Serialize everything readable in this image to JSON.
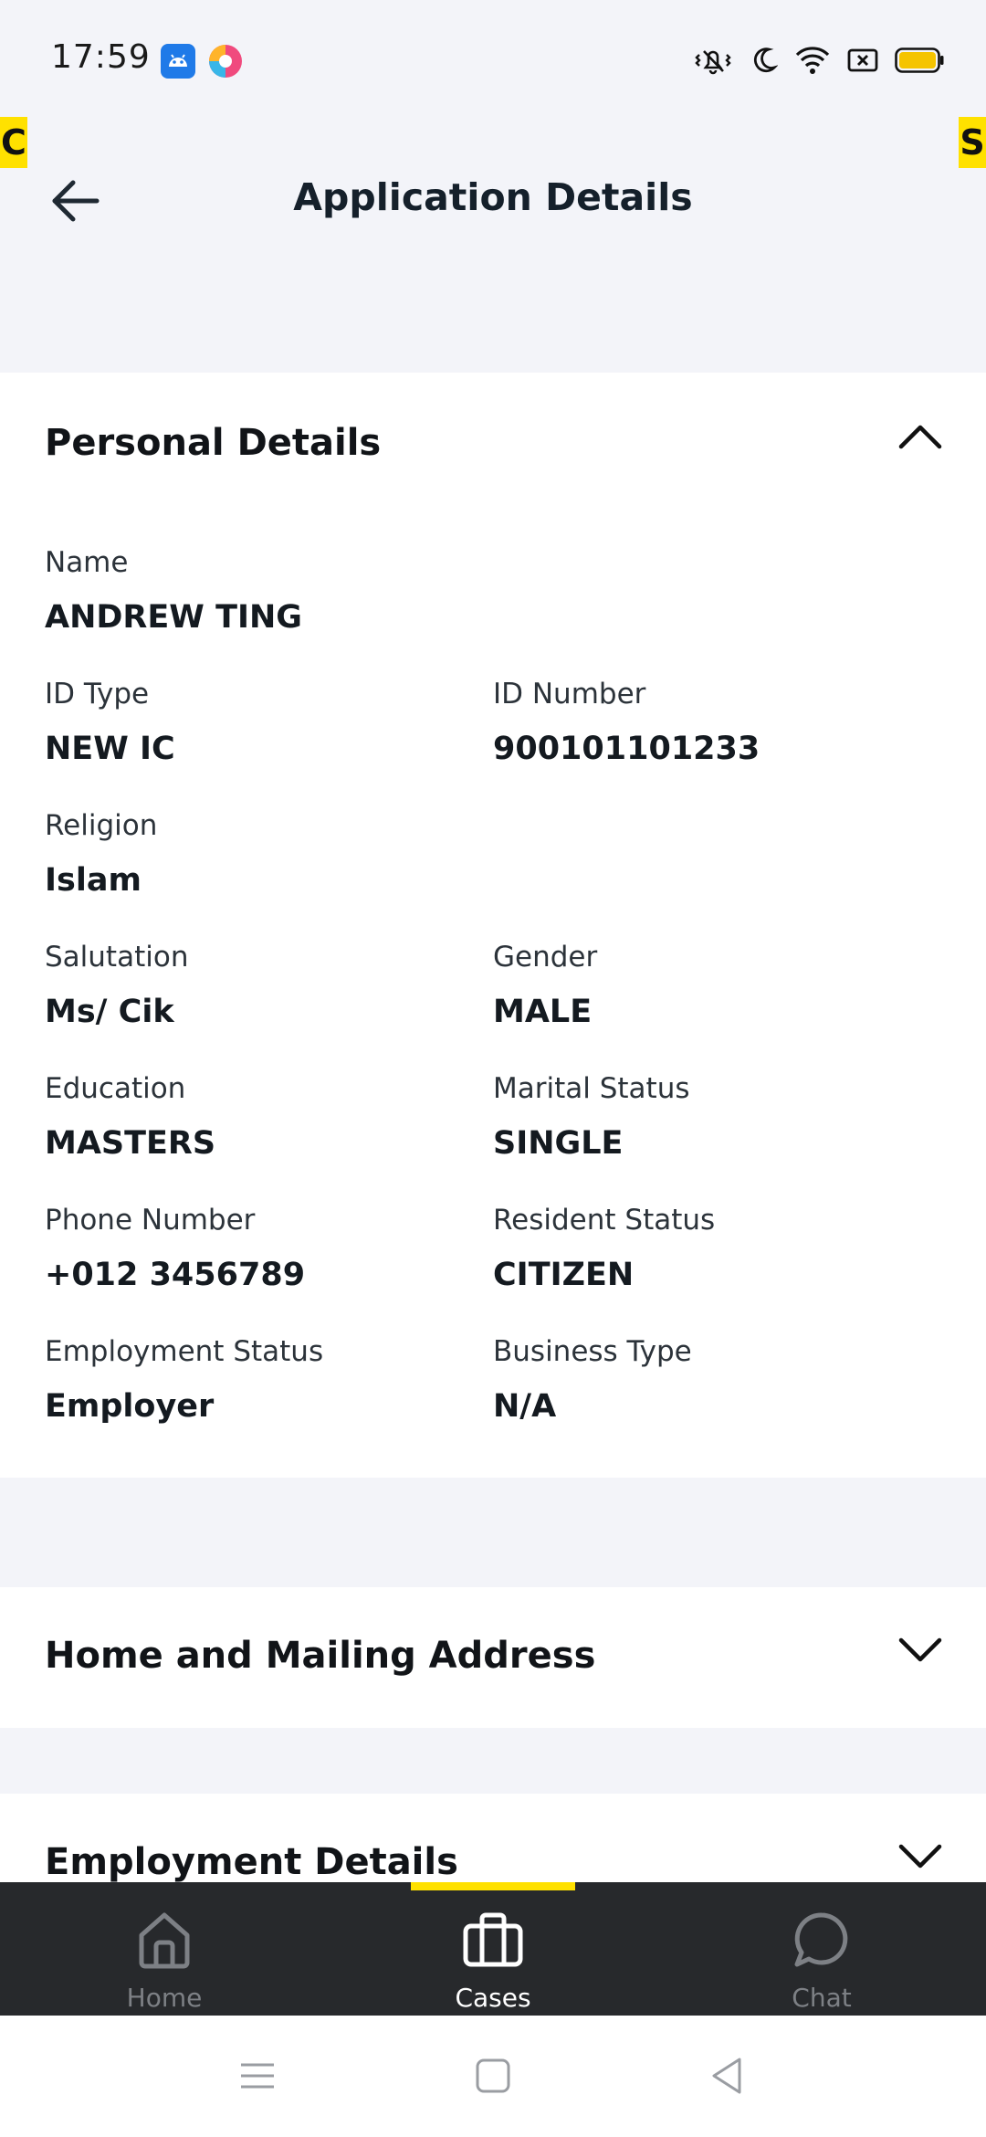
{
  "status_bar": {
    "time": "17:59",
    "app_icons": [
      "android-robot-icon",
      "browser-app-icon"
    ],
    "system_icons": [
      "vibrate-mute-icon",
      "moon-icon",
      "wifi-icon",
      "screen-record-icon",
      "battery-icon"
    ],
    "battery_color": "#f5c400"
  },
  "side_tags": {
    "left": "C",
    "right": "S"
  },
  "header": {
    "title": "Application Details",
    "back_icon": "back-arrow-icon"
  },
  "sections": {
    "personal": {
      "title": "Personal Details",
      "expanded": true,
      "fields": {
        "name": {
          "label": "Name",
          "value": "ANDREW TING"
        },
        "id_type": {
          "label": "ID Type",
          "value": "NEW IC"
        },
        "id_number": {
          "label": "ID Number",
          "value": "900101101233"
        },
        "religion": {
          "label": "Religion",
          "value": "Islam"
        },
        "salutation": {
          "label": "Salutation",
          "value": "Ms/ Cik"
        },
        "gender": {
          "label": "Gender",
          "value": "MALE"
        },
        "education": {
          "label": "Education",
          "value": "MASTERS"
        },
        "marital_status": {
          "label": "Marital Status",
          "value": "SINGLE"
        },
        "phone_number": {
          "label": "Phone Number",
          "value": "+012 3456789"
        },
        "resident_status": {
          "label": "Resident Status",
          "value": "CITIZEN"
        },
        "employment_status": {
          "label": "Employment Status",
          "value": "Employer"
        },
        "business_type": {
          "label": "Business Type",
          "value": "N/A"
        }
      }
    },
    "address": {
      "title": "Home and Mailing Address",
      "expanded": false
    },
    "employment": {
      "title": "Employment Details",
      "expanded": false
    }
  },
  "bottom_nav": {
    "active": "Cases",
    "accent": "#ffe100",
    "items": [
      {
        "label": "Home",
        "icon": "home-icon"
      },
      {
        "label": "Cases",
        "icon": "briefcase-icon"
      },
      {
        "label": "Chat",
        "icon": "chat-bubble-icon"
      }
    ]
  },
  "system_nav": {
    "icons": [
      "menu-icon",
      "home-square-icon",
      "back-triangle-icon"
    ]
  }
}
